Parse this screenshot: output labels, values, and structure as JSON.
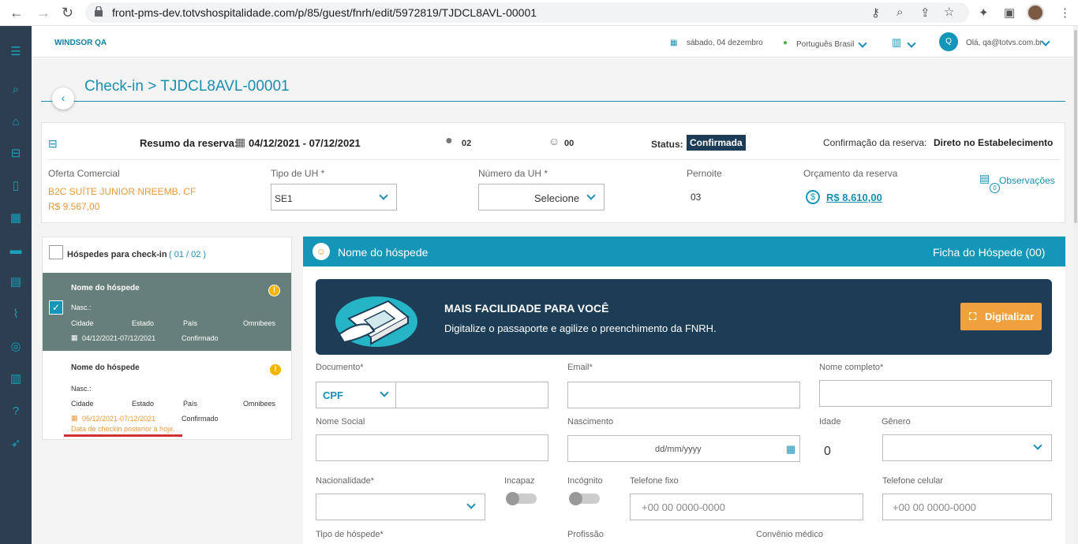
{
  "browser": {
    "url": "front-pms-dev.totvshospitalidade.com/p/85/guest/fnrh/edit/5972819/TJDCL8AVL-00001"
  },
  "topbar": {
    "brand": "WINDSOR QA",
    "date": "sábado, 04 dezembro",
    "language": "Português Brasil",
    "user_initial": "Q",
    "greeting": "Olá, qa@totvs.com.br"
  },
  "page": {
    "title": "Check-in > TJDCL8AVL-00001"
  },
  "reservation": {
    "summary_label": "Resumo da reserva:",
    "dates": "04/12/2021 - 07/12/2021",
    "adults": "02",
    "children": "00",
    "status_label": "Status:",
    "status": "Confirmada",
    "confirmation_label": "Confirmação da reserva:",
    "confirmation_value": "Direto no Estabelecimento",
    "offer_label": "Oferta Comercial",
    "offer_name": "B2C SUÍTE JUNIOR NREEMB. CF",
    "offer_price": "R$ 9.567,00",
    "uh_type_label": "Tipo de UH *",
    "uh_type": "SE1",
    "uh_number_label": "Número da UH *",
    "uh_number": "Selecione",
    "nights_label": "Pernoite",
    "nights": "03",
    "budget_label": "Orçamento da reserva",
    "budget": "R$ 8.610,00",
    "notes_count": "0",
    "notes_label": "Observações"
  },
  "guests": {
    "header": "Hóspedes para check-in",
    "count": "( 01 / 02 )",
    "items": [
      {
        "name": "Nome do hóspede",
        "birth": "Nasc.:",
        "city": "Cidade",
        "state": "Estado",
        "country": "País",
        "omni": "Omnibees",
        "dates": "04/12/2021-07/12/2021",
        "status": "Confirmado"
      },
      {
        "name": "Nome do hóspede",
        "birth": "Nasc.:",
        "city": "Cidade",
        "state": "Estado",
        "country": "País",
        "omni": "Omnibees",
        "dates": "05/12/2021-07/12/2021",
        "status": "Confirmado",
        "warning": "Data de checkin posterior à hoje."
      }
    ]
  },
  "form": {
    "header_name": "Nome do hóspede",
    "header_right": "Ficha do Hóspede (00)",
    "promo_title": "MAIS FACILIDADE PARA VOCÊ",
    "promo_text": "Digitalize o passaporte e agilize o preenchimento da FNRH.",
    "scan_button": "Digitalizar",
    "document_label": "Documento*",
    "document_type": "CPF",
    "email_label": "Email*",
    "fullname_label": "Nome completo*",
    "social_label": "Nome Social",
    "birth_label": "Nascimento",
    "birth_placeholder": "dd/mm/yyyy",
    "age_label": "Idade",
    "age_value": "0",
    "gender_label": "Gênero",
    "nationality_label": "Nacionalidade*",
    "incapaz_label": "Incapaz",
    "incognito_label": "Incógnito",
    "phone_label": "Telefone fixo",
    "phone_placeholder": "+00 00 0000-0000",
    "mobile_label": "Telefone celular",
    "mobile_placeholder": "+00 00 0000-0000",
    "guest_type_label": "Tipo de hóspede*",
    "profession_label": "Profissão",
    "health_label": "Convênio médico"
  },
  "colors": {
    "accent": "#1496b9",
    "sidebar": "#2c3e50",
    "orange": "#e89a3c",
    "warning_red": "#d32f2f"
  }
}
